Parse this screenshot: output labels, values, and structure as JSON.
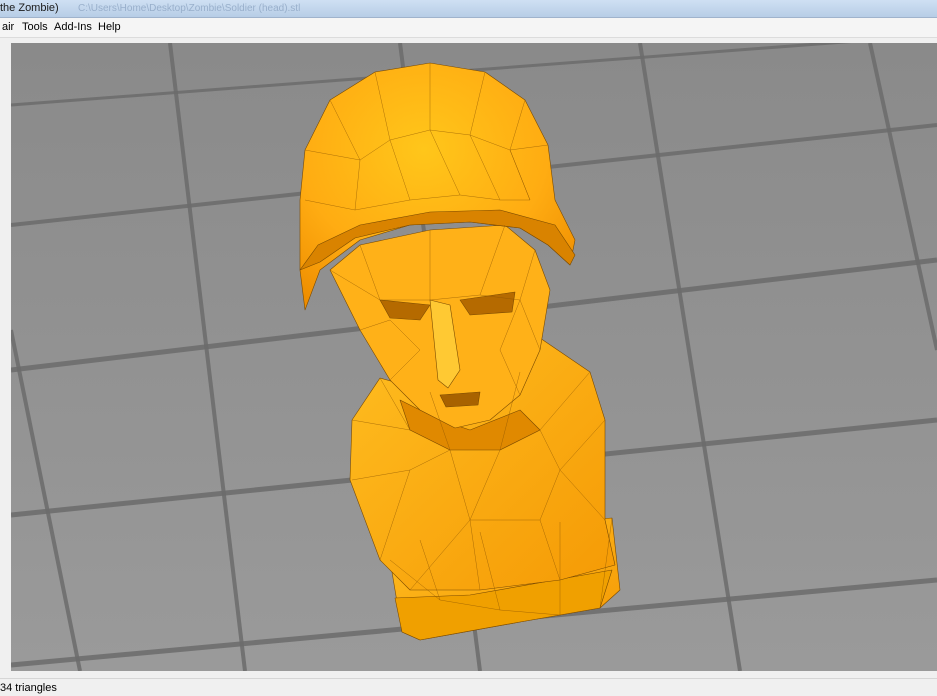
{
  "window": {
    "title": "the Zombie)",
    "file_path": "C:\\Users\\Home\\Desktop\\Zombie\\Soldier (head).stl"
  },
  "menu": {
    "items": [
      "air",
      "Tools",
      "Add-Ins",
      "Help"
    ]
  },
  "status": {
    "triangles_text": "34 triangles"
  },
  "colors": {
    "model": "#ffb21a",
    "grid_background": "#8f8f8f",
    "grid_lines": "#666666"
  },
  "icons": []
}
